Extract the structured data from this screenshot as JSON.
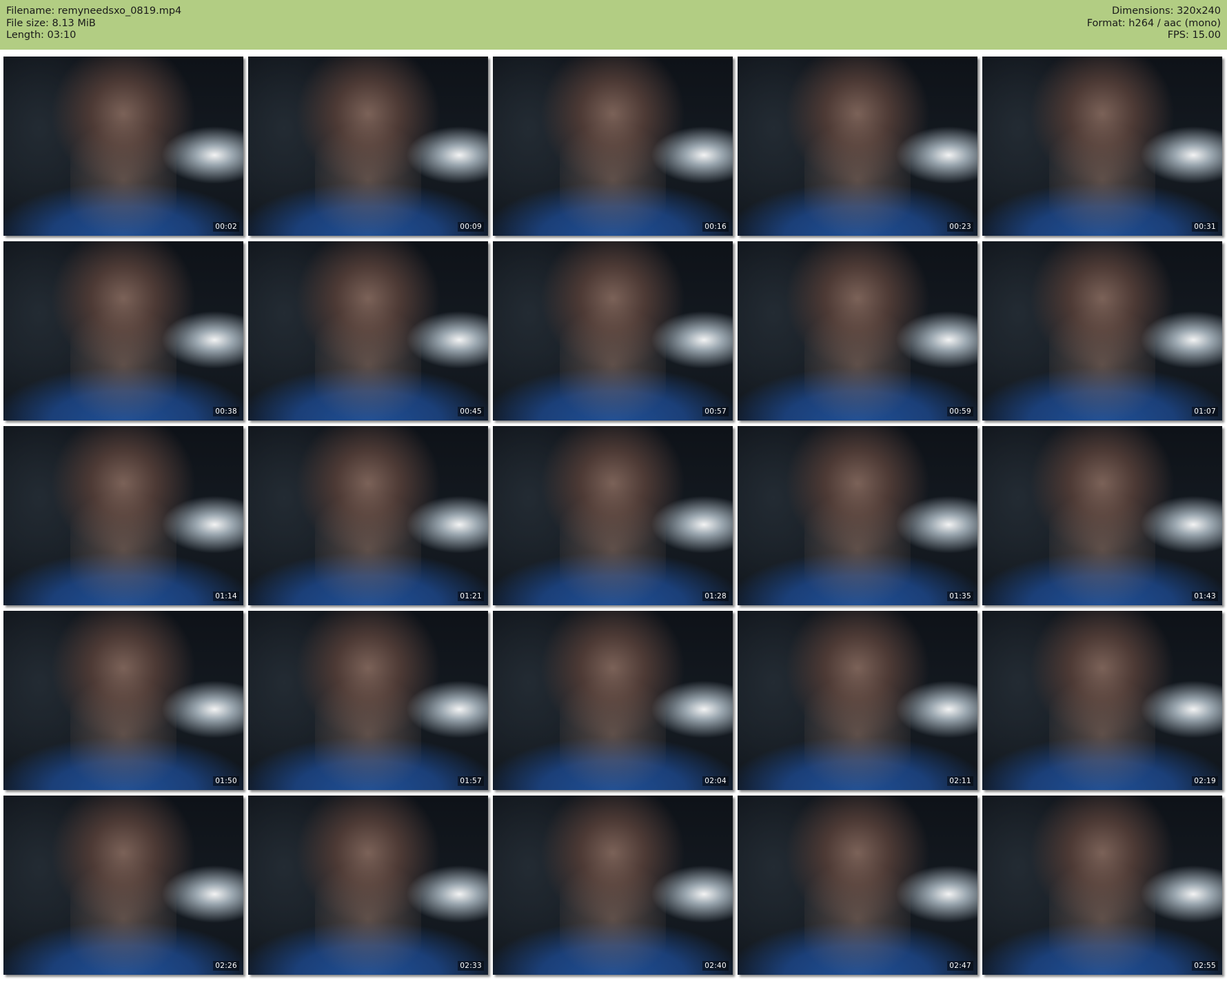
{
  "header": {
    "left": [
      {
        "label": "Filename:",
        "value": "remyneedsxo_0819.mp4"
      },
      {
        "label": "File size:",
        "value": "8.13 MiB"
      },
      {
        "label": "Length:",
        "value": "03:10"
      }
    ],
    "right": [
      {
        "label": "Dimensions:",
        "value": "320x240"
      },
      {
        "label": "Format:",
        "value": "h264 / aac (mono)"
      },
      {
        "label": "FPS:",
        "value": "15.00"
      }
    ]
  },
  "thumbnails": [
    {
      "timestamp": "00:02"
    },
    {
      "timestamp": "00:09"
    },
    {
      "timestamp": "00:16"
    },
    {
      "timestamp": "00:23"
    },
    {
      "timestamp": "00:31"
    },
    {
      "timestamp": "00:38"
    },
    {
      "timestamp": "00:45"
    },
    {
      "timestamp": "00:57"
    },
    {
      "timestamp": "00:59"
    },
    {
      "timestamp": "01:07"
    },
    {
      "timestamp": "01:14"
    },
    {
      "timestamp": "01:21"
    },
    {
      "timestamp": "01:28"
    },
    {
      "timestamp": "01:35"
    },
    {
      "timestamp": "01:43"
    },
    {
      "timestamp": "01:50"
    },
    {
      "timestamp": "01:57"
    },
    {
      "timestamp": "02:04"
    },
    {
      "timestamp": "02:11"
    },
    {
      "timestamp": "02:19"
    },
    {
      "timestamp": "02:26"
    },
    {
      "timestamp": "02:33"
    },
    {
      "timestamp": "02:40"
    },
    {
      "timestamp": "02:47"
    },
    {
      "timestamp": "02:55"
    }
  ],
  "colors": {
    "header_bg": "#b2cd83",
    "page_bg": "#ffffff"
  }
}
